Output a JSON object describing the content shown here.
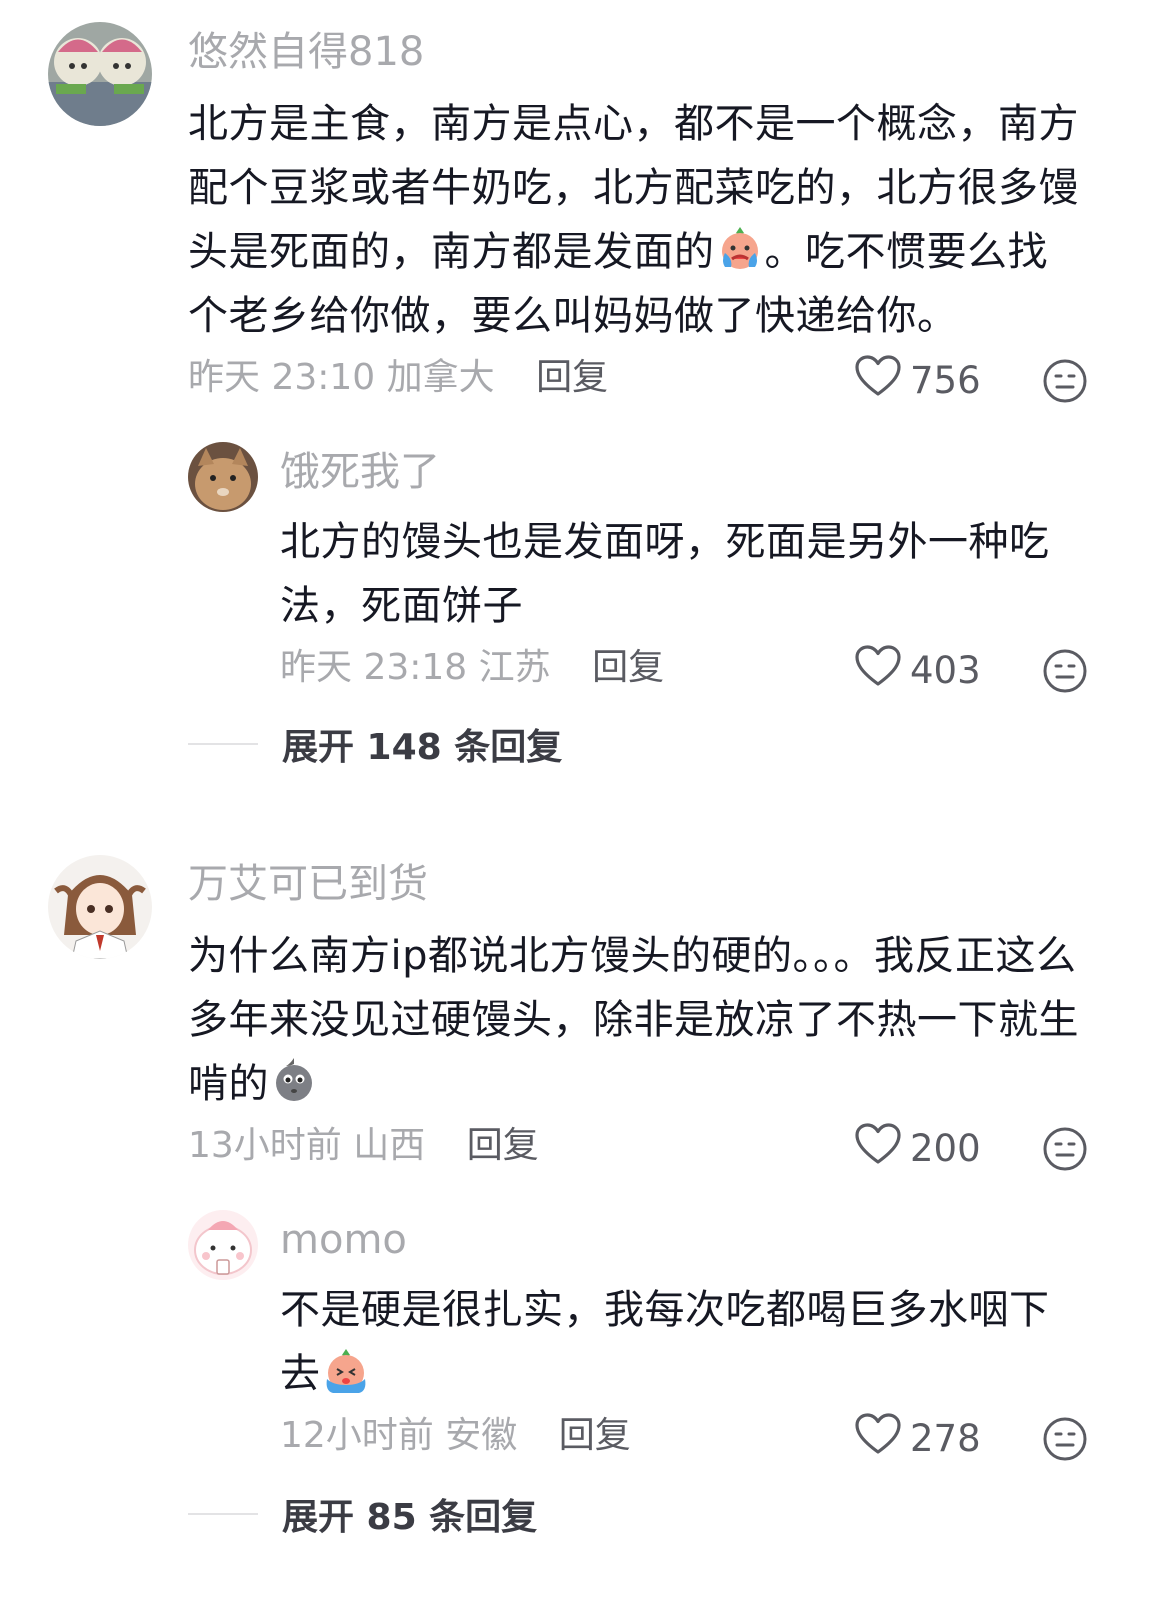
{
  "comments": [
    {
      "username": "悠然自得818",
      "text_parts": [
        "北方是主食，南方是点心，都不是一个概念，南方配个豆浆或者牛奶吃，北方配菜吃的，北方很多馒头是死面的，南方都是发面的",
        "。吃不惯要么找个老乡给你做，要么叫妈妈做了快递给你。"
      ],
      "emoji": "crying-face-emoji",
      "time": "昨天 23:10",
      "location": "加拿大",
      "reply_label": "回复",
      "likes": "756",
      "replies": [
        {
          "username": "饿死我了",
          "text": "北方的馒头也是发面呀，死面是另外一种吃法，死面饼子",
          "time": "昨天 23:18",
          "location": "江苏",
          "reply_label": "回复",
          "likes": "403"
        }
      ],
      "expand_label": "展开 148 条回复"
    },
    {
      "username": "万艾可已到货",
      "text_parts": [
        "为什么南方ip都说北方馒头的硬的。。。我反正这么多年来没见过硬馒头，除非是放凉了不热一下就生啃的",
        ""
      ],
      "emoji": "sweat-face-emoji",
      "time": "13小时前",
      "location": "山西",
      "reply_label": "回复",
      "likes": "200",
      "replies": [
        {
          "username": "momo",
          "text": "不是硬是很扎实，我每次吃都喝巨多水咽下去",
          "emoji": "crying-face-emoji",
          "time": "12小时前",
          "location": "安徽",
          "reply_label": "回复",
          "likes": "278"
        }
      ],
      "expand_label": "展开 85 条回复"
    }
  ]
}
